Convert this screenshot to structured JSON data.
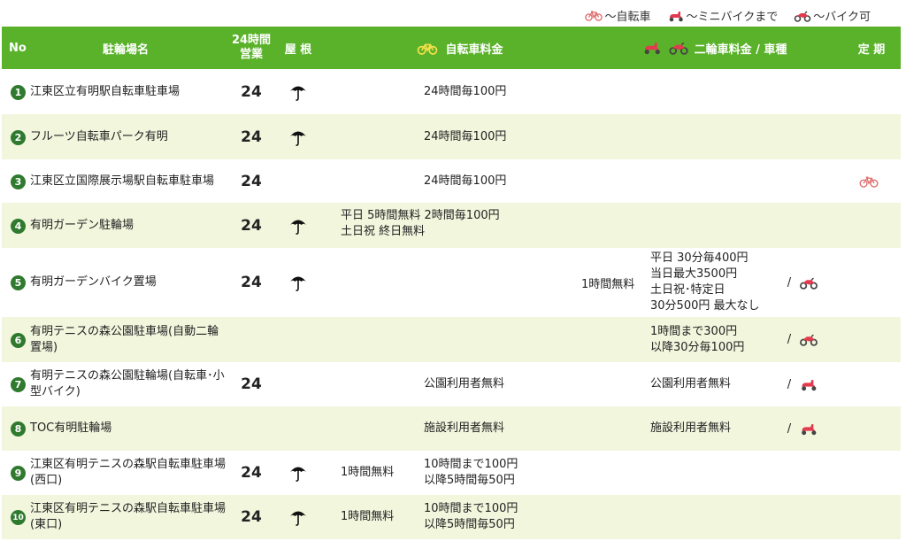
{
  "legend": {
    "bicycle": "～自転車",
    "minibike": "～ミニバイクまで",
    "bike": "～バイク可"
  },
  "header": {
    "no": "No",
    "name": "駐輪場名",
    "hours_line1": "24時間",
    "hours_line2": "営業",
    "roof": "屋 根",
    "bicycle_fee": "自転車料金",
    "motorcycle_fee": "二輪車料金 / 車種",
    "pass": "定 期"
  },
  "rows": [
    {
      "no": "1",
      "name": "江東区立有明駅自転車駐車場",
      "h24": "24",
      "roof": true,
      "bfree": "",
      "bfee": "24時間毎100円",
      "mfree": "",
      "mfee": "",
      "vehicle": "",
      "pass": false
    },
    {
      "no": "2",
      "name": "フルーツ自転車パーク有明",
      "h24": "24",
      "roof": true,
      "bfree": "",
      "bfee": "24時間毎100円",
      "mfree": "",
      "mfee": "",
      "vehicle": "",
      "pass": false
    },
    {
      "no": "3",
      "name": "江東区立国際展示場駅自転車駐車場",
      "h24": "24",
      "roof": false,
      "bfree": "",
      "bfee": "24時間毎100円",
      "mfree": "",
      "mfee": "",
      "vehicle": "",
      "pass": true
    },
    {
      "no": "4",
      "name": "有明ガーデン駐輪場",
      "h24": "24",
      "roof": true,
      "bfree": "平日 5時間無料 2時間毎100円\n土日祝 終日無料",
      "bfee": "",
      "mfree": "",
      "mfee": "",
      "vehicle": "",
      "pass": false
    },
    {
      "no": "5",
      "name": "有明ガーデンバイク置場",
      "h24": "24",
      "roof": true,
      "bfree": "",
      "bfee": "",
      "mfree": "1時間無料",
      "mfee": "平日 30分毎400円\n当日最大3500円\n土日祝･特定日\n30分500円 最大なし",
      "vehicle": "bike",
      "pass": false
    },
    {
      "no": "6",
      "name": "有明テニスの森公園駐車場(自動二輪置場)",
      "h24": "",
      "roof": false,
      "bfree": "",
      "bfee": "",
      "mfree": "",
      "mfee": "1時間まで300円\n以降30分毎100円",
      "vehicle": "bike",
      "pass": false
    },
    {
      "no": "7",
      "name": "有明テニスの森公園駐輪場(自転車･小型バイク)",
      "h24": "24",
      "roof": false,
      "bfree": "",
      "bfee": "公園利用者無料",
      "mfree": "",
      "mfee": "公園利用者無料",
      "vehicle": "minibike",
      "pass": false
    },
    {
      "no": "8",
      "name": "TOC有明駐輪場",
      "h24": "",
      "roof": false,
      "bfree": "",
      "bfee": "施設利用者無料",
      "mfree": "",
      "mfee": "施設利用者無料",
      "vehicle": "minibike",
      "pass": false
    },
    {
      "no": "9",
      "name": "江東区有明テニスの森駅自転車駐車場(西口)",
      "h24": "24",
      "roof": true,
      "bfree": "1時間無料",
      "bfee": "10時間まで100円\n以降5時間毎50円",
      "mfree": "",
      "mfee": "",
      "vehicle": "",
      "pass": false
    },
    {
      "no": "10",
      "name": "江東区有明テニスの森駅自転車駐車場(東口)",
      "h24": "24",
      "roof": true,
      "bfree": "1時間無料",
      "bfee": "10時間まで100円\n以降5時間毎50円",
      "mfree": "",
      "mfee": "",
      "vehicle": "",
      "pass": false
    }
  ]
}
